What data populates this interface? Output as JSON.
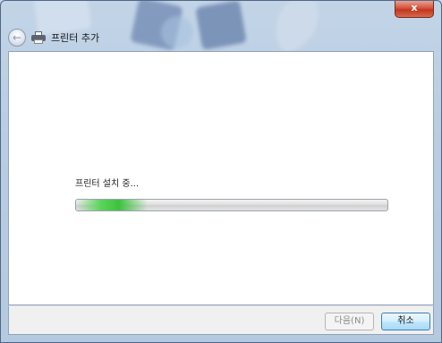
{
  "window": {
    "title": "프린터 추가",
    "close_label": "x"
  },
  "icons": {
    "back": "back-arrow-icon",
    "printer": "printer-icon",
    "close": "close-icon"
  },
  "main": {
    "status": "프린터 설치 중...",
    "progress_percent": 23
  },
  "footer": {
    "next_label": "다음(N)",
    "cancel_label": "취소"
  },
  "colors": {
    "progress": "#3ec23e",
    "cancel_border": "#3c7fb1",
    "close_button": "#c2361f"
  }
}
